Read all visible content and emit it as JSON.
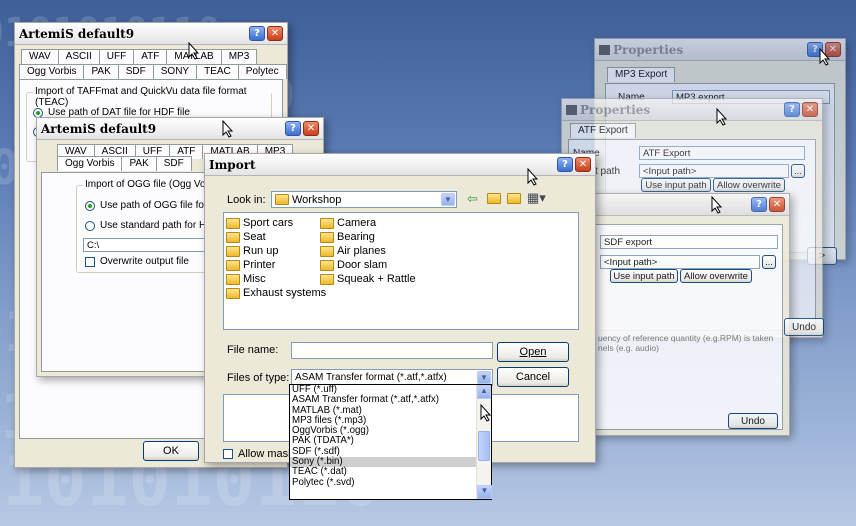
{
  "background": {
    "digits": [
      "0101010110",
      "1010001110",
      "0011101001",
      "1100101010",
      "0101100111",
      "1010011010"
    ]
  },
  "win1": {
    "title": "ArtemiS   default9",
    "tabs_row1": [
      "WAV",
      "ASCII",
      "UFF",
      "ATF",
      "MATLAB",
      "MP3"
    ],
    "tabs_row2": [
      "Ogg Vorbis",
      "PAK",
      "SDF",
      "SONY",
      "TEAC",
      "Polytec"
    ],
    "group_label": "Import of TAFFmat and QuickVu data file format (TEAC)",
    "radio1": "Use path of DAT file for HDF file",
    "ok_label": "OK"
  },
  "win2": {
    "title": "ArtemiS   default9",
    "tabs_row1": [
      "WAV",
      "ASCII",
      "UFF",
      "ATF",
      "MATLAB",
      "MP3"
    ],
    "tabs_row2": [
      "Ogg Vorbis",
      "PAK",
      "SDF"
    ],
    "group_label": "Import of OGG file (Ogg Vorbis)",
    "radio1": "Use path of OGG file for HDF fi",
    "radio2": "Use standard path for HDF file:",
    "path_value": "C:\\",
    "overwrite_label": "Overwrite output file",
    "ok_label": "OK"
  },
  "prop1": {
    "title": "Properties",
    "tab": "MP3 Export",
    "name_label": "Name",
    "name_value": "MP3 export"
  },
  "prop2": {
    "title": "Properties",
    "tab": "ATF Export",
    "name_label": "Name",
    "name_value": "ATF Export",
    "path_label": "t path",
    "path_value": "<Input path>",
    "btn_input": "Use input path",
    "btn_overwrite": "Allow overwrite"
  },
  "prop3": {
    "name_value": "SDF export",
    "path_value": "<Input path>",
    "btn_input": "Use input path",
    "btn_overwrite": "Allow overwrite",
    "desc1": "uency of reference quantity (e.g.RPM) is taken",
    "desc2": "nels (e.g. audio)",
    "undo_label": "Undo"
  },
  "prop_back_undo": "Undo",
  "import": {
    "title": "Import",
    "look_in_label": "Look in:",
    "look_in_value": "Workshop",
    "folders_col1": [
      "Sport cars",
      "Seat",
      "Run up",
      "Printer",
      "Misc",
      "Exhaust systems"
    ],
    "folders_col2": [
      "Camera",
      "Bearing",
      "Air planes",
      "Door slam",
      "Squeak + Rattle"
    ],
    "file_name_label": "File name:",
    "file_name_value": "",
    "files_of_type_label": "Files of type:",
    "files_of_type_value": "ASAM Transfer format (*.atf,*.atfx)",
    "open_label": "Open",
    "cancel_label": "Cancel",
    "allow_mask_label": "Allow mask f",
    "type_options": [
      "UFF (*.uff)",
      "ASAM Transfer format (*.atf,*.atfx)",
      "MATLAB (*.mat)",
      "MP3 files (*.mp3)",
      "OggVorbis (*.ogg)",
      "PAK (TDATA*)",
      "SDF (*.sdf)",
      "Sony (*.bin)",
      "TEAC (*.dat)",
      "Polytec (*.svd)"
    ],
    "highlighted_option": "Sony (*.bin)"
  }
}
